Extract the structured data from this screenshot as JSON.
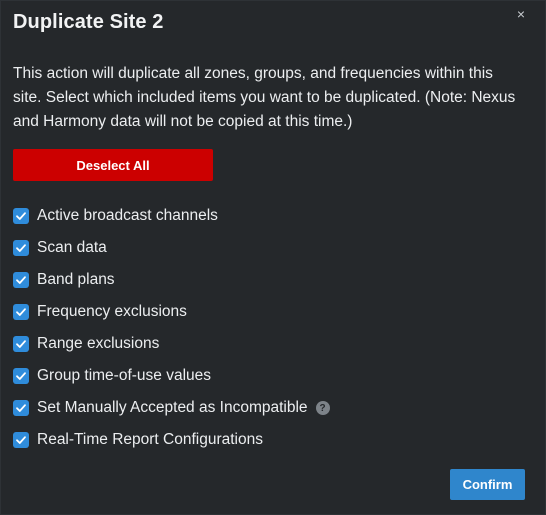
{
  "dialog": {
    "title": "Duplicate Site 2",
    "close_label": "×",
    "description": "This action will duplicate all zones, groups, and frequencies within this site. Select which included items you want to be duplicated. (Note: Nexus and Harmony data will not be copied at this time.)",
    "deselect_label": "Deselect All",
    "confirm_label": "Confirm",
    "options": [
      {
        "label": "Active broadcast channels",
        "checked": true
      },
      {
        "label": "Scan data",
        "checked": true
      },
      {
        "label": "Band plans",
        "checked": true
      },
      {
        "label": "Frequency exclusions",
        "checked": true
      },
      {
        "label": "Range exclusions",
        "checked": true
      },
      {
        "label": "Group time-of-use values",
        "checked": true
      },
      {
        "label": "Set Manually Accepted as Incompatible",
        "checked": true,
        "help_icon": "question-circle-icon",
        "help_glyph": "?"
      },
      {
        "label": "Real-Time Report Configurations",
        "checked": true
      }
    ]
  },
  "colors": {
    "background": "#25282b",
    "deselect_button": "#cc0000",
    "confirm_button": "#2f86cc",
    "checkbox": "#2f8cdb"
  }
}
